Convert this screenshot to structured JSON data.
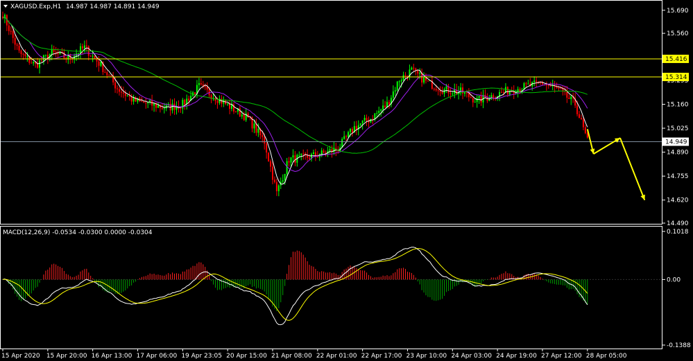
{
  "header": {
    "symbol": "XAGUSD.Exp,H1",
    "ohlc": "14.987 14.987 14.891 14.949"
  },
  "macd_header": {
    "text": "MACD(12,26,9) -0.0534 -0.0300 0.0000 -0.0304"
  },
  "colors": {
    "background": "#000000",
    "frame": "#ffffff",
    "bull_candle": "#00ff00",
    "bear_candle": "#ff0000",
    "sma_fast": "#ffffff",
    "sma_mid": "#a020f0",
    "sma_slow": "#00c000",
    "level_lines": "#ffff00",
    "bid_line": "#8090a0",
    "forecast_arrow": "#ffff00",
    "macd_main": "#ffffff",
    "macd_signal": "#ffff00",
    "hist_up": "#ff2020",
    "hist_down": "#00a000"
  },
  "chart_data": [
    {
      "type": "candlestick",
      "title": "XAGUSD.Exp,H1",
      "ylim": [
        14.49,
        15.74
      ],
      "y_ticks": [
        "15.690",
        "15.560",
        "15.295",
        "15.160",
        "15.025",
        "14.890",
        "14.755",
        "14.620",
        "14.490"
      ],
      "x_ticks": [
        "15 Apr 2020",
        "15 Apr 20:00",
        "16 Apr 13:00",
        "17 Apr 06:00",
        "19 Apr 23:05",
        "20 Apr 15:00",
        "21 Apr 08:00",
        "22 Apr 01:00",
        "22 Apr 17:00",
        "23 Apr 10:00",
        "24 Apr 03:00",
        "24 Apr 19:00",
        "27 Apr 12:00",
        "28 Apr 05:00"
      ],
      "horizontal_levels": [
        {
          "label": "15.416",
          "value": 15.416
        },
        {
          "label": "15.314",
          "value": 15.314
        }
      ],
      "bid": {
        "label": "14.949",
        "value": 14.949
      },
      "close_path": [
        [
          0,
          15.67
        ],
        [
          8,
          15.45
        ],
        [
          16,
          15.38
        ],
        [
          24,
          15.45
        ],
        [
          32,
          15.42
        ],
        [
          40,
          15.48
        ],
        [
          48,
          15.38
        ],
        [
          56,
          15.25
        ],
        [
          64,
          15.18
        ],
        [
          72,
          15.16
        ],
        [
          80,
          15.14
        ],
        [
          88,
          15.16
        ],
        [
          96,
          15.26
        ],
        [
          104,
          15.2
        ],
        [
          112,
          15.14
        ],
        [
          120,
          15.08
        ],
        [
          128,
          14.95
        ],
        [
          134,
          14.66
        ],
        [
          140,
          14.85
        ],
        [
          148,
          14.86
        ],
        [
          156,
          14.88
        ],
        [
          164,
          14.91
        ],
        [
          172,
          15.03
        ],
        [
          180,
          15.08
        ],
        [
          188,
          15.16
        ],
        [
          194,
          15.3
        ],
        [
          200,
          15.35
        ],
        [
          208,
          15.28
        ],
        [
          216,
          15.24
        ],
        [
          224,
          15.23
        ],
        [
          232,
          15.18
        ],
        [
          240,
          15.21
        ],
        [
          248,
          15.24
        ],
        [
          256,
          15.26
        ],
        [
          264,
          15.28
        ],
        [
          272,
          15.24
        ],
        [
          280,
          15.16
        ],
        [
          286,
          14.95
        ]
      ],
      "forecast": [
        {
          "from": 286,
          "from_value": 15.02,
          "to": 289,
          "to_value": 14.88
        },
        {
          "from": 289,
          "from_value": 14.88,
          "to": 302,
          "to_value": 14.97
        },
        {
          "from": 302,
          "from_value": 14.97,
          "to": 314,
          "to_value": 14.62
        }
      ]
    },
    {
      "type": "macd",
      "title": "MACD(12,26,9)",
      "params": [
        12,
        26,
        9
      ],
      "values": {
        "main": -0.0534,
        "signal": -0.03,
        "zero": 0.0,
        "histogram": -0.0304
      },
      "ylim": [
        -0.1388,
        0.1018
      ],
      "y_ticks": [
        "0.1018",
        "0.00",
        "-0.1388"
      ]
    }
  ]
}
